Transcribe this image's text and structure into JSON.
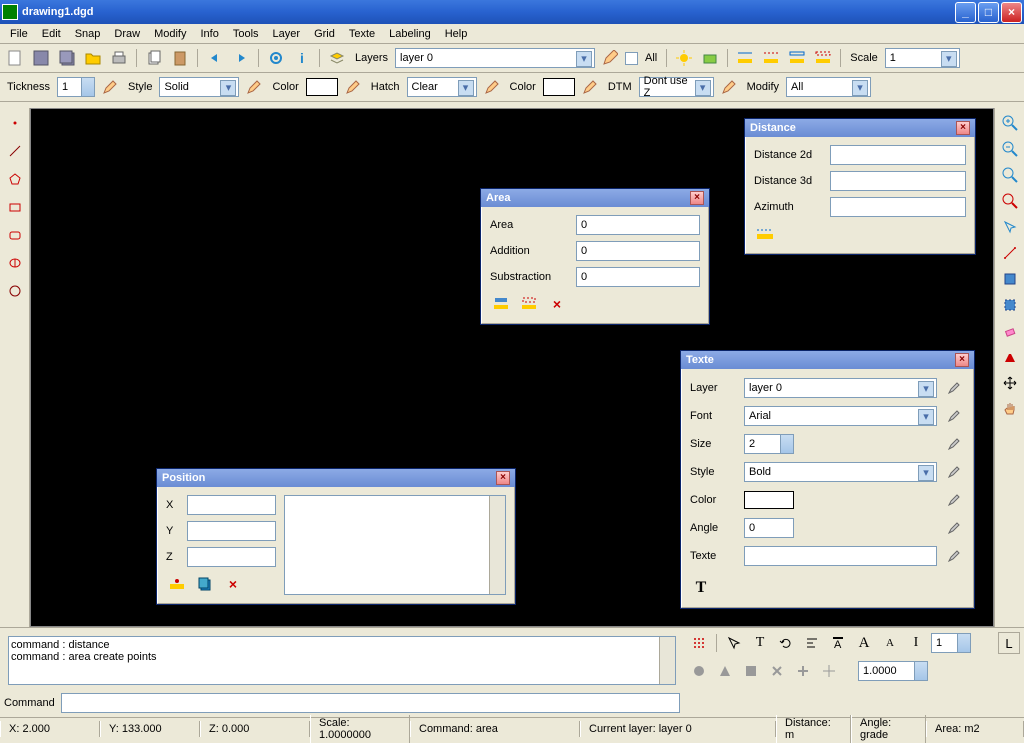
{
  "window": {
    "title": "drawing1.dgd"
  },
  "menu": [
    "File",
    "Edit",
    "Snap",
    "Draw",
    "Modify",
    "Info",
    "Tools",
    "Layer",
    "Grid",
    "Texte",
    "Labeling",
    "Help"
  ],
  "toolbar1": {
    "layers_label": "Layers",
    "layers_value": "layer 0",
    "all_label": "All",
    "scale_label": "Scale",
    "scale_value": "1"
  },
  "toolbar2": {
    "thickness_label": "Tickness",
    "thickness_value": "1",
    "style_label": "Style",
    "style_value": "Solid",
    "color_label": "Color",
    "hatch_label": "Hatch",
    "hatch_value": "Clear",
    "color2_label": "Color",
    "dtm_label": "DTM",
    "dtm_value": "Dont use Z",
    "modify_label": "Modify",
    "modify_value": "All"
  },
  "panels": {
    "distance": {
      "title": "Distance",
      "d2d_label": "Distance 2d",
      "d2d_value": "",
      "d3d_label": "Distance 3d",
      "d3d_value": "",
      "az_label": "Azimuth",
      "az_value": ""
    },
    "area": {
      "title": "Area",
      "area_label": "Area",
      "area_value": "0",
      "add_label": "Addition",
      "add_value": "0",
      "sub_label": "Substraction",
      "sub_value": "0"
    },
    "position": {
      "title": "Position",
      "x_label": "X",
      "x_value": "",
      "y_label": "Y",
      "y_value": "",
      "z_label": "Z",
      "z_value": ""
    },
    "texte": {
      "title": "Texte",
      "layer_label": "Layer",
      "layer_value": "layer 0",
      "font_label": "Font",
      "font_value": "Arial",
      "size_label": "Size",
      "size_value": "2",
      "style_label": "Style",
      "style_value": "Bold",
      "color_label": "Color",
      "angle_label": "Angle",
      "angle_value": "0",
      "texte_label": "Texte",
      "texte_value": ""
    }
  },
  "cmdlog": {
    "line1": "command : distance",
    "line2": "command : area   create points"
  },
  "cmdline_label": "Command",
  "tools_right": {
    "num_value": "1",
    "precision_value": "1.0000"
  },
  "status": {
    "x": "X: 2.000",
    "y": "Y: 133.000",
    "z": "Z: 0.000",
    "scale": "Scale: 1.0000000",
    "command": "Command: area",
    "layer": "Current layer: layer 0",
    "distance": "Distance: m",
    "angle": "Angle: grade",
    "area": "Area: m2"
  }
}
